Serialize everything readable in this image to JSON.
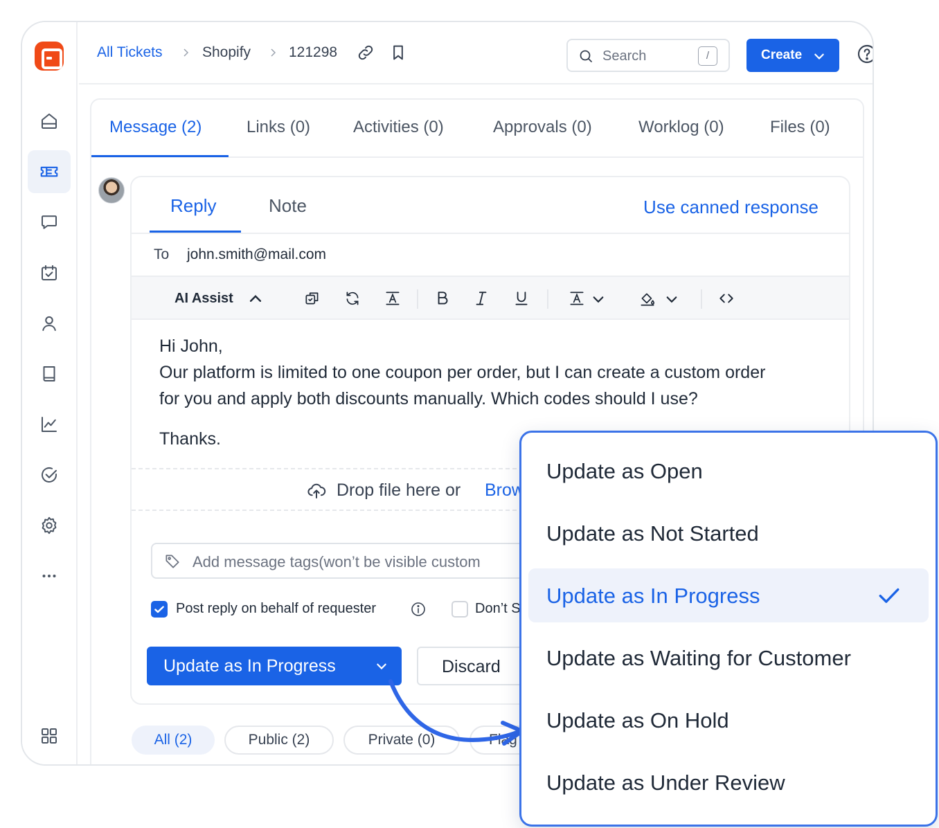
{
  "breadcrumb": {
    "items": [
      "All Tickets",
      "Shopify",
      "121298"
    ]
  },
  "search": {
    "placeholder": "Search",
    "shortcut": "/"
  },
  "header": {
    "create_label": "Create"
  },
  "sidebar": {
    "items": [
      {
        "icon": "home-icon"
      },
      {
        "icon": "ticket-icon",
        "active": true
      },
      {
        "icon": "chat-icon"
      },
      {
        "icon": "calendar-check-icon"
      },
      {
        "icon": "user-icon"
      },
      {
        "icon": "book-icon"
      },
      {
        "icon": "chart-icon"
      },
      {
        "icon": "check-circle-icon"
      },
      {
        "icon": "gear-icon"
      },
      {
        "icon": "more-icon"
      },
      {
        "icon": "grid-icon"
      }
    ]
  },
  "main_tabs": [
    "Message (2)",
    "Links (0)",
    "Activities (0)",
    "Approvals (0)",
    "Worklog (0)",
    "Files (0)"
  ],
  "composer": {
    "tabs": [
      "Reply",
      "Note"
    ],
    "canned_label": "Use canned response",
    "to_label": "To",
    "to_value": "john.smith@mail.com",
    "ai_assist_label": "AI Assist",
    "body": {
      "greeting": "Hi John,",
      "line1": "Our platform is limited to one coupon per order, but I can create a custom order",
      "line2": "for you and apply both discounts manually. Which codes should I use?",
      "signoff": "Thanks."
    },
    "drop_text": "Drop file here or",
    "drop_link": "Brow",
    "tags_placeholder": "Add message tags(won’t be visible custom",
    "checkbox_post_label": "Post reply on behalf of requester",
    "checkbox_dont_label": "Don’t S",
    "primary_button_label": "Update as In Progress",
    "discard_label": "Discard"
  },
  "filters": [
    "All (2)",
    "Public (2)",
    "Private (0)",
    "Flag"
  ],
  "status_dropdown": {
    "options": [
      "Update as Open",
      "Update as Not Started",
      "Update as In Progress",
      "Update as Waiting for Customer",
      "Update as On Hold",
      "Update as Under Review"
    ],
    "selected_index": 2
  },
  "colors": {
    "accent": "#1a63e6",
    "logo": "#f04a17"
  }
}
